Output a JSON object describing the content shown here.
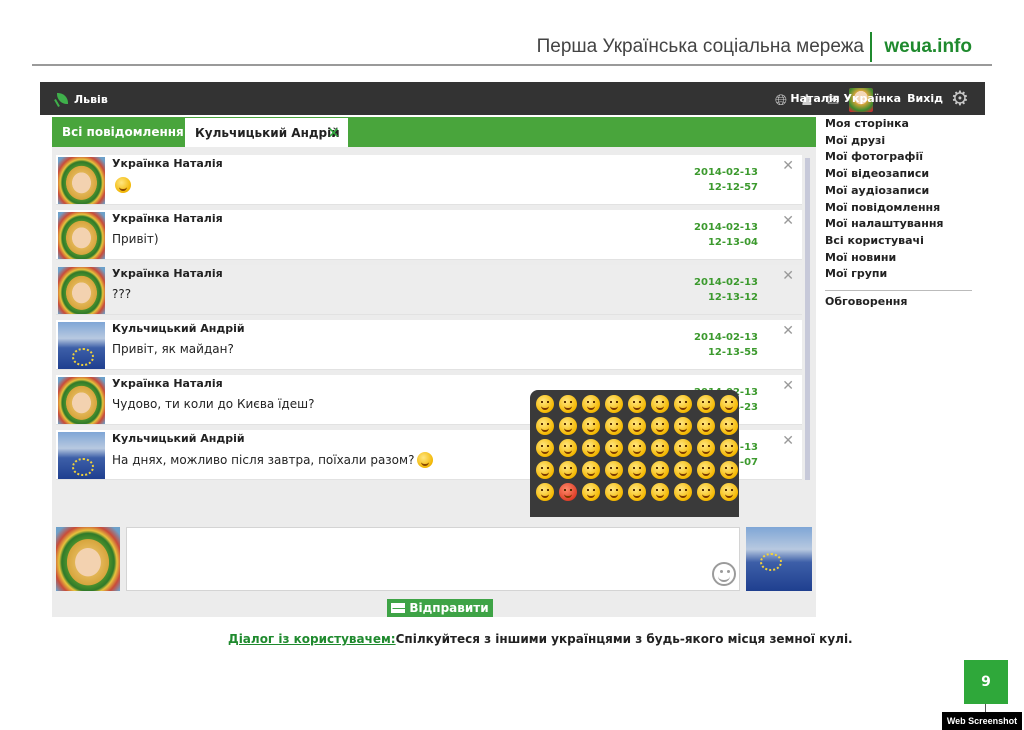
{
  "doc": {
    "title": "Перша Українська соціальна мережа",
    "brand": "weua.info"
  },
  "topbar": {
    "location": "Львів",
    "user_name": "Наталія Українка",
    "logout": "Вихід"
  },
  "tabs": {
    "all": "Всі повідомлення",
    "active": "Кульчицький Андрій"
  },
  "messages": [
    {
      "author": "Українка Наталія",
      "text": "",
      "has_smiley": true,
      "date": "2014-02-13",
      "time": "12-12-57",
      "avatar": "natalia"
    },
    {
      "author": "Українка Наталія",
      "text": "Привіт)",
      "has_smiley": false,
      "date": "2014-02-13",
      "time": "12-13-04",
      "avatar": "natalia"
    },
    {
      "author": "Українка Наталія",
      "text": "???",
      "has_smiley": false,
      "date": "2014-02-13",
      "time": "12-13-12",
      "avatar": "natalia",
      "highlighted": true
    },
    {
      "author": "Кульчицький Андрій",
      "text": "Привіт, як майдан?",
      "has_smiley": false,
      "date": "2014-02-13",
      "time": "12-13-55",
      "avatar": "andriy"
    },
    {
      "author": "Українка Наталія",
      "text": "Чудово, ти коли до Києва їдеш?",
      "has_smiley": false,
      "date": "2014-02-13",
      "time": "12-14-23",
      "avatar": "natalia"
    },
    {
      "author": "Кульчицький Андрій",
      "text": "На днях, можливо після завтра, поїхали разом?",
      "has_smiley": true,
      "date": "2014-02-13",
      "time": "12-15-07",
      "avatar": "andriy"
    }
  ],
  "emoji_count": 45,
  "composer": {
    "send_label": "Відправити"
  },
  "sidebar": {
    "items": [
      "Моя сторінка",
      "Мої друзі",
      "Мої фотографії",
      "Мої відеозаписи",
      "Мої аудіозаписи",
      "Мої повідомлення",
      "Мої налаштування",
      "Всі користувачі",
      "Мої новини",
      "Мої групи"
    ],
    "discussions": "Обговорення"
  },
  "caption": {
    "link": "Діалог із користувачем:",
    "text": "Спілкуйтеся з іншими українцями з будь-якого місця земної кулі."
  },
  "page_number": "9",
  "watermark": "Web Screenshot"
}
